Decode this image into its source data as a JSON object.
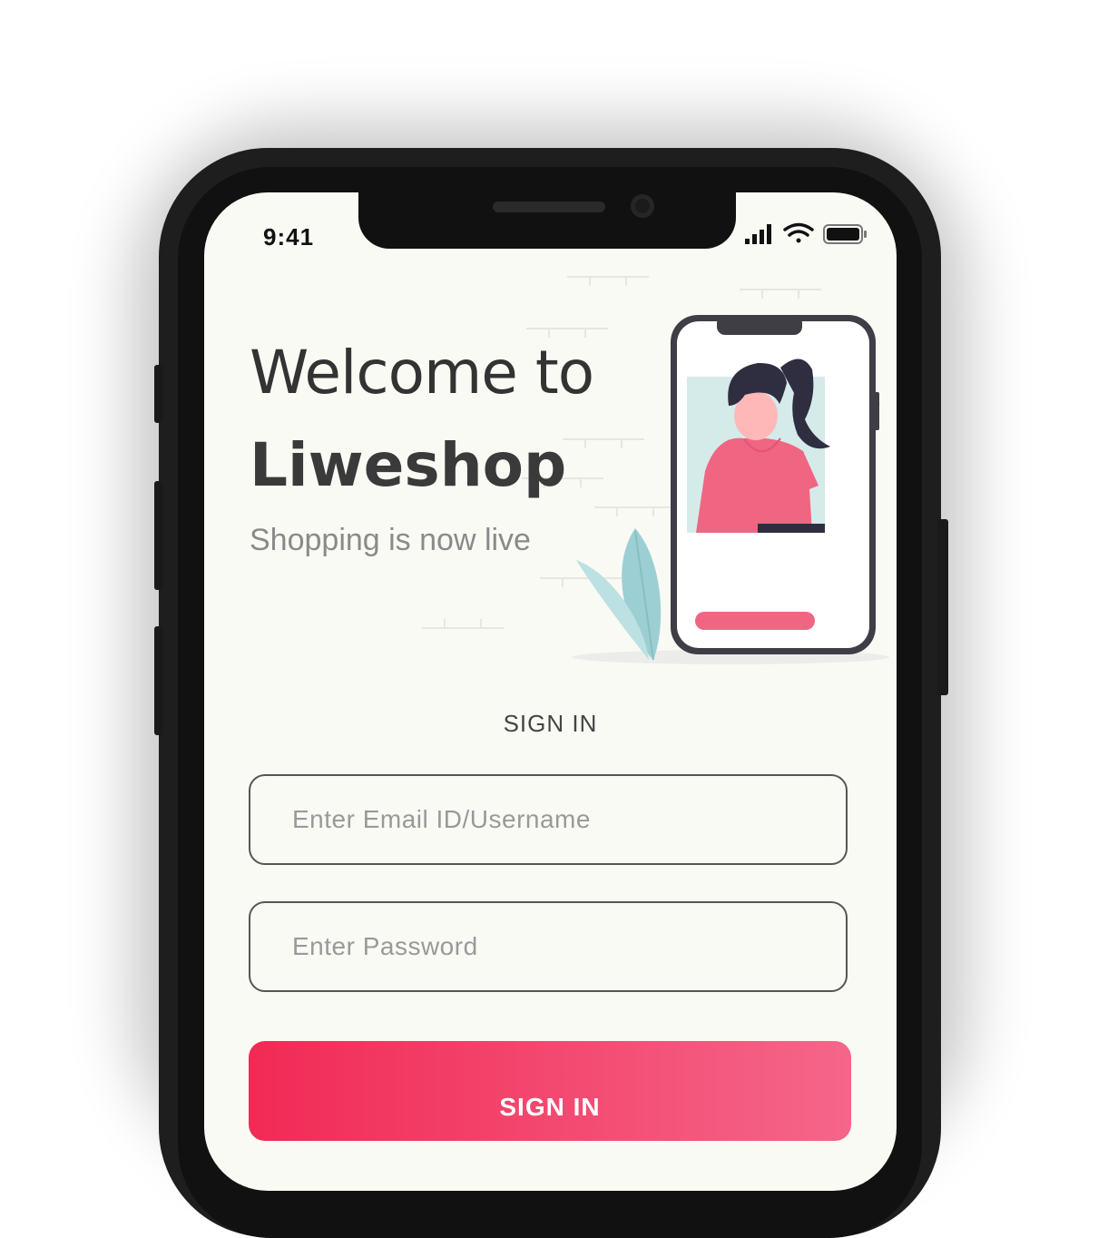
{
  "status_bar": {
    "time": "9:41",
    "icons": [
      "signal-icon",
      "wifi-icon",
      "battery-icon"
    ]
  },
  "welcome": {
    "line1": "Welcome to",
    "brand": "Liweshop",
    "tagline": "Shopping is now live"
  },
  "form": {
    "heading": "SIGN IN",
    "email_placeholder": "Enter Email ID/Username",
    "password_placeholder": "Enter Password",
    "submit_label": "SIGN IN"
  },
  "colors": {
    "accent_start": "#f12a55",
    "accent_end": "#f5668a",
    "screen_background": "#fafaf5",
    "illustration_teal": "#9ccfd3",
    "illustration_pink": "#f06682"
  }
}
